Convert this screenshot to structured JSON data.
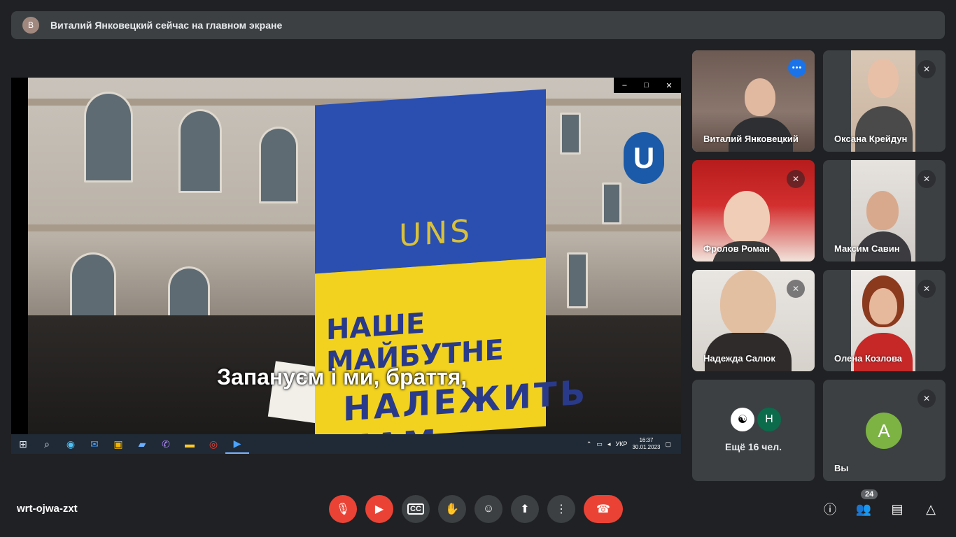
{
  "banner": {
    "avatar_letter": "В",
    "text": "Виталий Янковецкий сейчас на главном экране"
  },
  "stage": {
    "subtitle": "Запануєм і ми, браття,",
    "flag_text_top": "UNS",
    "flag_text_mid": "НАШЕ МАЙБУТНЕ",
    "flag_text_bottom": "НАЛЕЖИТЬ НАМ",
    "metro_sign": "U",
    "window_controls": [
      "–",
      "□",
      "✕"
    ],
    "taskbar": {
      "lang": "УКР",
      "time": "16:37",
      "date": "30.01.2023"
    }
  },
  "participants": [
    {
      "name": "Виталий Янковецкий",
      "speaking": true
    },
    {
      "name": "Оксана Крейдун",
      "muted": true
    },
    {
      "name": "Фролов Роман",
      "muted": true
    },
    {
      "name": "Максим Савин",
      "muted": true
    },
    {
      "name": "Надежда Салюк",
      "muted": true
    },
    {
      "name": "Олена Козлова",
      "muted": true
    }
  ],
  "more_tile": {
    "avatar_letter": "Н",
    "text": "Ещё 16 чел."
  },
  "self_tile": {
    "avatar_letter": "А",
    "name": "Вы"
  },
  "meeting": {
    "code": "wrt-ojwa-zxt",
    "participant_count": "24"
  },
  "colors": {
    "background": "#202124",
    "tile": "#3c4043",
    "danger": "#ea4335",
    "accent": "#8ab4f8"
  }
}
